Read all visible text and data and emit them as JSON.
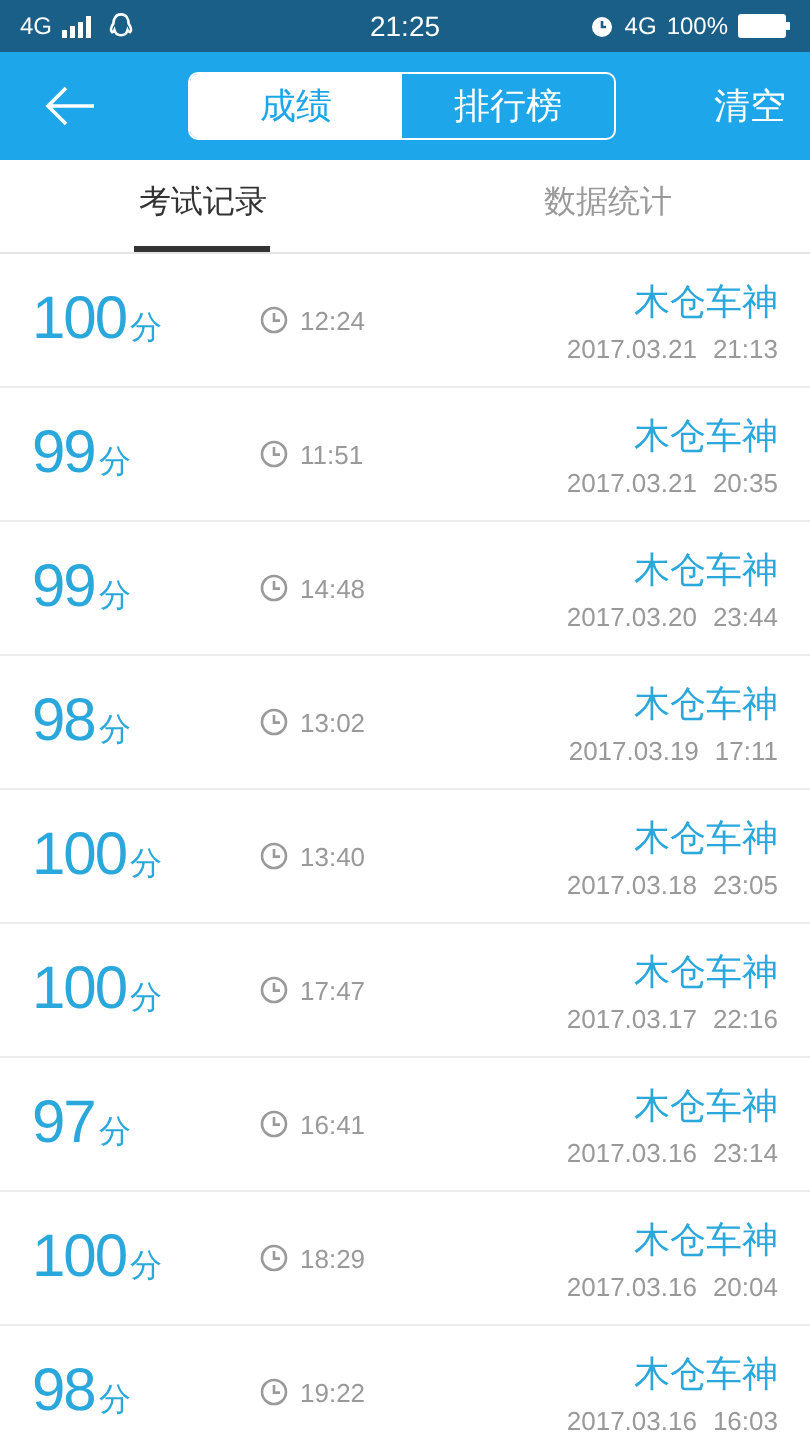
{
  "status_bar": {
    "network_left": "4G",
    "time": "21:25",
    "network_right": "4G",
    "battery": "100%"
  },
  "header": {
    "segments": [
      {
        "label": "成绩",
        "selected": true
      },
      {
        "label": "排行榜",
        "selected": false
      }
    ],
    "action": "清空"
  },
  "tabs": [
    {
      "label": "考试记录",
      "selected": true
    },
    {
      "label": "数据统计",
      "selected": false
    }
  ],
  "records": [
    {
      "score": "100",
      "unit": "分",
      "duration": "12:24",
      "name": "木仓车神",
      "date": "2017.03.21",
      "time": "21:13"
    },
    {
      "score": "99",
      "unit": "分",
      "duration": "11:51",
      "name": "木仓车神",
      "date": "2017.03.21",
      "time": "20:35"
    },
    {
      "score": "99",
      "unit": "分",
      "duration": "14:48",
      "name": "木仓车神",
      "date": "2017.03.20",
      "time": "23:44"
    },
    {
      "score": "98",
      "unit": "分",
      "duration": "13:02",
      "name": "木仓车神",
      "date": "2017.03.19",
      "time": "17:11"
    },
    {
      "score": "100",
      "unit": "分",
      "duration": "13:40",
      "name": "木仓车神",
      "date": "2017.03.18",
      "time": "23:05"
    },
    {
      "score": "100",
      "unit": "分",
      "duration": "17:47",
      "name": "木仓车神",
      "date": "2017.03.17",
      "time": "22:16"
    },
    {
      "score": "97",
      "unit": "分",
      "duration": "16:41",
      "name": "木仓车神",
      "date": "2017.03.16",
      "time": "23:14"
    },
    {
      "score": "100",
      "unit": "分",
      "duration": "18:29",
      "name": "木仓车神",
      "date": "2017.03.16",
      "time": "20:04"
    },
    {
      "score": "98",
      "unit": "分",
      "duration": "19:22",
      "name": "木仓车神",
      "date": "2017.03.16",
      "time": "16:03"
    }
  ]
}
